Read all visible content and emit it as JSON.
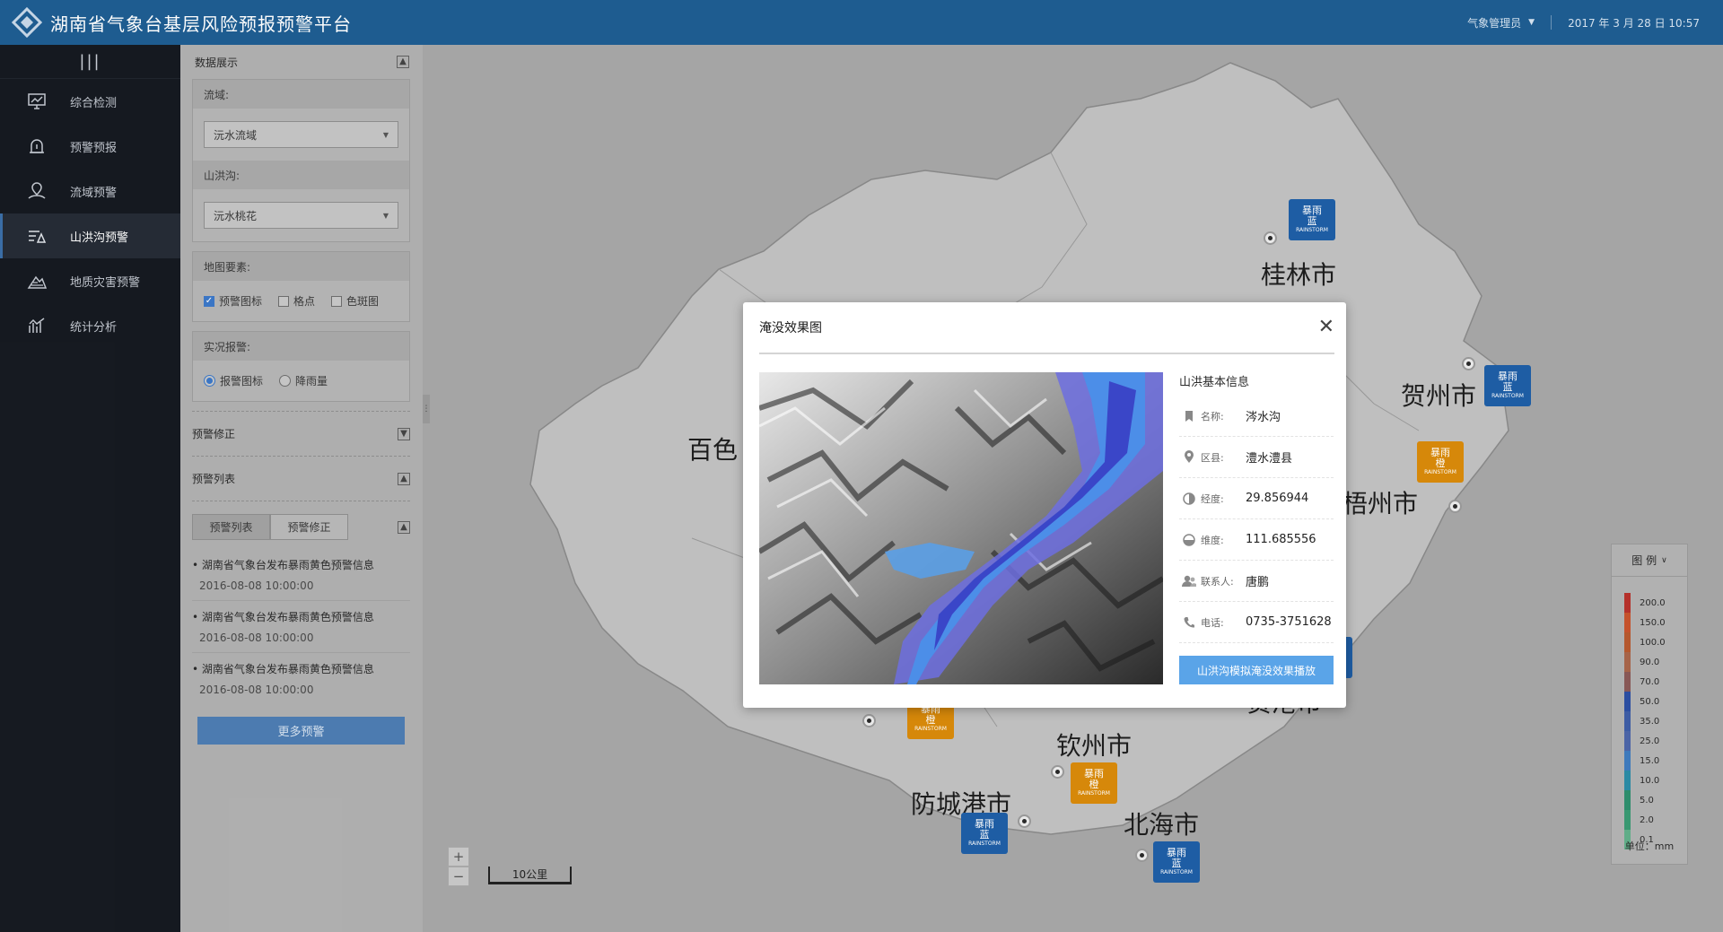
{
  "header": {
    "title": "湖南省气象台基层风险预报预警平台",
    "user": "气象管理员",
    "datetime": "2017 年 3 月 28 日 10:57"
  },
  "sidebar": {
    "toggle": "|||",
    "items": [
      {
        "label": "综合检测",
        "icon": "monitor-icon"
      },
      {
        "label": "预警预报",
        "icon": "alarm-icon"
      },
      {
        "label": "流域预警",
        "icon": "basin-pin-icon"
      },
      {
        "label": "山洪沟预警",
        "icon": "flood-icon",
        "active": true
      },
      {
        "label": "地质灾害预警",
        "icon": "landslide-icon"
      },
      {
        "label": "统计分析",
        "icon": "chart-icon"
      }
    ]
  },
  "panel": {
    "title": "数据展示",
    "toggle": "▲",
    "basin_label": "流域:",
    "basin_value": "沅水流域",
    "gully_label": "山洪沟:",
    "gully_value": "沅水桃花",
    "map_elements_label": "地图要素:",
    "map_elements": [
      {
        "label": "预警图标",
        "checked": true
      },
      {
        "label": "格点",
        "checked": false
      },
      {
        "label": "色斑图",
        "checked": false
      }
    ],
    "live_report_label": "实况报警:",
    "live_report": [
      {
        "label": "报警图标",
        "checked": true
      },
      {
        "label": "降雨量",
        "checked": false
      }
    ],
    "correction_label": "预警修正",
    "correction_toggle": "▼",
    "list_label": "预警列表",
    "list_toggle": "▲",
    "tabs": [
      "预警列表",
      "预警修正"
    ],
    "tabs_toggle": "▲",
    "warnings": [
      {
        "title": "湖南省气象台发布暴雨黄色预警信息",
        "date": "2016-08-08 10:00:00"
      },
      {
        "title": "湖南省气象台发布暴雨黄色预警信息",
        "date": "2016-08-08 10:00:00"
      },
      {
        "title": "湖南省气象台发布暴雨黄色预警信息",
        "date": "2016-08-08 10:00:00"
      }
    ],
    "more_button": "更多预警"
  },
  "map": {
    "cities": [
      "桂林市",
      "贺州市",
      "梧州市",
      "百色",
      "钦州市",
      "防城港市",
      "北海市",
      "贵港市"
    ],
    "storm_icon_text": "暴雨",
    "storm_icon_level_blue": "蓝",
    "storm_icon_level_orange": "橙",
    "storm_icon_sub": "RAINSTORM",
    "zoom_in": "+",
    "zoom_out": "−",
    "scale": "10公里",
    "colors": {
      "blue": "#1f5fa6",
      "orange": "#d98a0b"
    }
  },
  "legend": {
    "title": "图 例",
    "unit": "单位：mm",
    "levels": [
      {
        "value": "200.0",
        "color": "#b8322c"
      },
      {
        "value": "150.0",
        "color": "#c8532d"
      },
      {
        "value": "100.0",
        "color": "#b85a2f"
      },
      {
        "value": "90.0",
        "color": "#a8664a"
      },
      {
        "value": "70.0",
        "color": "#8a5a58"
      },
      {
        "value": "50.0",
        "color": "#2d4fa3"
      },
      {
        "value": "35.0",
        "color": "#3e5ea6"
      },
      {
        "value": "25.0",
        "color": "#4c66a8"
      },
      {
        "value": "15.0",
        "color": "#3f7cbf"
      },
      {
        "value": "10.0",
        "color": "#2c8ca6"
      },
      {
        "value": "5.0",
        "color": "#2f8f6e"
      },
      {
        "value": "2.0",
        "color": "#3a9a73"
      },
      {
        "value": "0.1",
        "color": "#62b08a"
      }
    ]
  },
  "modal": {
    "title": "淹没效果图",
    "close": "✕",
    "info_title": "山洪基本信息",
    "rows": [
      {
        "key": "名称:",
        "value": "涔水沟",
        "icon": "bookmark-icon"
      },
      {
        "key": "区县:",
        "value": "澧水澧县",
        "icon": "location-pin-icon"
      },
      {
        "key": "经度:",
        "value": "29.856944",
        "icon": "longitude-icon"
      },
      {
        "key": "维度:",
        "value": "111.685556",
        "icon": "latitude-icon"
      },
      {
        "key": "联系人:",
        "value": "唐鹏",
        "icon": "contact-person-icon"
      },
      {
        "key": "电话:",
        "value": "0735-3751628",
        "icon": "phone-icon"
      }
    ],
    "play_button": "山洪沟模拟淹没效果播放"
  }
}
